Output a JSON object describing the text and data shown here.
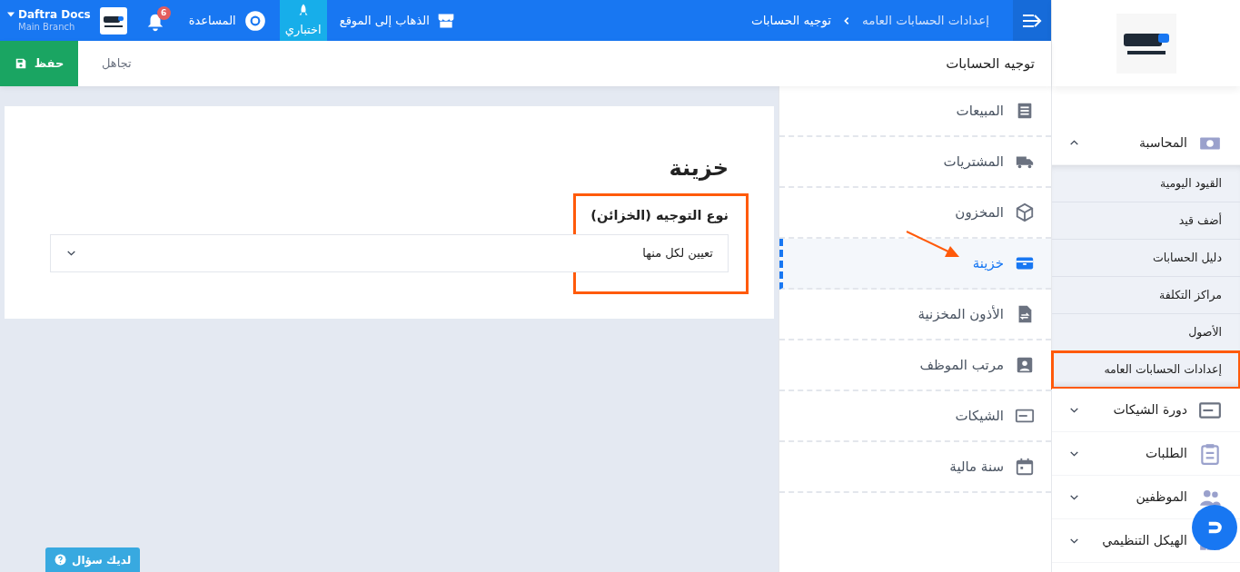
{
  "topbar": {
    "breadcrumb": [
      "إعدادات الحسابات العامه",
      "توجيه الحسابات"
    ],
    "links": [
      {
        "kind": "site",
        "label": "الذهاب إلى الموقع",
        "selected": false
      },
      {
        "kind": "test",
        "label": "اختباري",
        "selected": true
      },
      {
        "kind": "help",
        "label": "المساعدة",
        "selected": false
      }
    ],
    "notifications": "6",
    "account": {
      "name": "Daftra Docs",
      "branch": "Main Branch"
    }
  },
  "page": {
    "title": "توجيه الحسابات",
    "buttons": [
      {
        "kind": "discard",
        "label": "تجاهل"
      },
      {
        "kind": "save",
        "label": "حفظ"
      }
    ]
  },
  "settings_menu": [
    {
      "label": "المبيعات",
      "selected": false,
      "arrow": false
    },
    {
      "label": "المشتريات",
      "selected": false,
      "arrow": false
    },
    {
      "label": "المخزون",
      "selected": false,
      "arrow": false
    },
    {
      "label": "خزينة",
      "selected": true,
      "arrow": true
    },
    {
      "label": "الأذون المخزنية",
      "selected": false,
      "arrow": false
    },
    {
      "label": "مرتب الموظف",
      "selected": false,
      "arrow": false
    },
    {
      "label": "الشيكات",
      "selected": false,
      "arrow": false
    },
    {
      "label": "سنة مالية",
      "selected": false,
      "arrow": false
    }
  ],
  "form": {
    "title": "خزينة",
    "field_label": "نوع التوجيه (الخزائن)",
    "value": "تعيين لكل منها",
    "highlighted": true
  },
  "sidebar": [
    {
      "label": "المحاسبة",
      "expanded": true,
      "children": [
        {
          "label": "القيود اليومية",
          "highlighted": false
        },
        {
          "label": "أضف قيد",
          "highlighted": false
        },
        {
          "label": "دليل الحسابات",
          "highlighted": false
        },
        {
          "label": "مراكز التكلفة",
          "highlighted": false
        },
        {
          "label": "الأصول",
          "highlighted": false
        },
        {
          "label": "إعدادات الحسابات العامه",
          "highlighted": true
        }
      ]
    },
    {
      "label": "دورة الشيكات",
      "expanded": false
    },
    {
      "label": "الطلبات",
      "expanded": false
    },
    {
      "label": "الموظفين",
      "expanded": false
    },
    {
      "label": "الهيكل التنظيمي",
      "expanded": false
    }
  ],
  "help_button": "لديك سؤال"
}
